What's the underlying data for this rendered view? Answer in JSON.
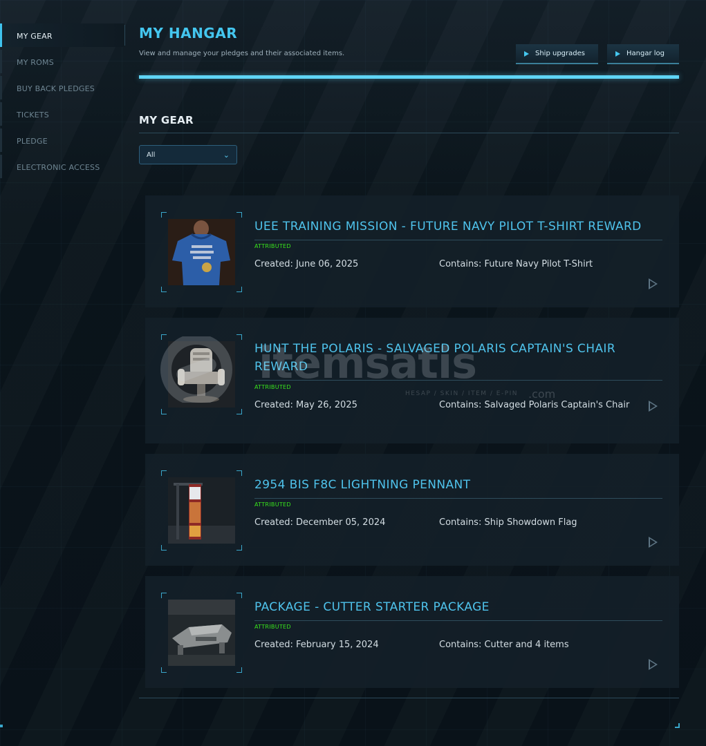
{
  "sidebar": {
    "items": [
      {
        "label": "MY GEAR",
        "active": true
      },
      {
        "label": "MY ROMS",
        "active": false
      },
      {
        "label": "BUY BACK PLEDGES",
        "active": false
      },
      {
        "label": "TICKETS",
        "active": false
      },
      {
        "label": "PLEDGE",
        "active": false
      },
      {
        "label": "ELECTRONIC ACCESS",
        "active": false
      }
    ]
  },
  "header": {
    "title": "MY HANGAR",
    "subtitle": "View and manage your pledges and their associated items.",
    "buttons": {
      "upgrades": "Ship upgrades",
      "log": "Hangar log"
    }
  },
  "section": {
    "title": "MY GEAR"
  },
  "filter": {
    "selected": "All"
  },
  "cards": [
    {
      "title": "UEE TRAINING MISSION - FUTURE NAVY PILOT T-SHIRT REWARD",
      "badge": "ATTRIBUTED",
      "created": "Created: June 06, 2025",
      "contains": "Contains: Future Navy Pilot T-Shirt"
    },
    {
      "title": "HUNT THE POLARIS - SALVAGED POLARIS CAPTAIN'S CHAIR REWARD",
      "badge": "ATTRIBUTED",
      "created": "Created: May 26, 2025",
      "contains": "Contains: Salvaged Polaris Captain's Chair"
    },
    {
      "title": "2954 BIS F8C LIGHTNING PENNANT",
      "badge": "ATTRIBUTED",
      "created": "Created: December 05, 2024",
      "contains": "Contains: Ship Showdown Flag"
    },
    {
      "title": "PACKAGE - CUTTER STARTER PACKAGE",
      "badge": "ATTRIBUTED",
      "created": "Created: February 15, 2024",
      "contains": "Contains: Cutter and 4 items"
    }
  ],
  "watermark": {
    "name": "itemsatis",
    "tagline": "HESAP / SKIN / ITEM / E-PIN",
    "domain": ".com"
  },
  "colors": {
    "accent": "#44c6ef",
    "attributed": "#39e61c",
    "background": "#0a1319"
  }
}
